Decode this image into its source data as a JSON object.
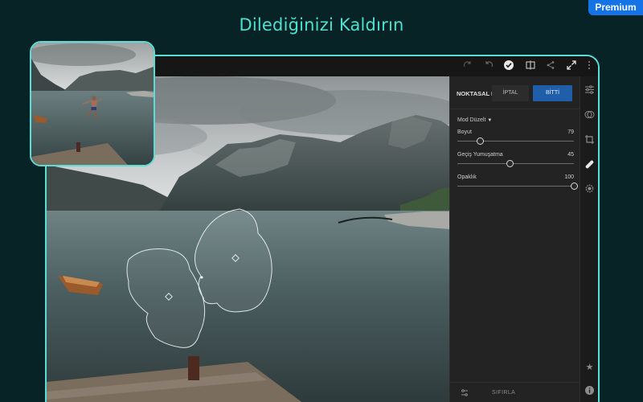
{
  "header": {
    "title": "Dilediğinizi Kaldırın"
  },
  "badge": {
    "label": "Premium"
  },
  "topbar": {
    "icons": [
      "redo-icon",
      "undo-icon",
      "checkmark-icon",
      "compare-icon",
      "share-icon",
      "fullscreen-icon",
      "more-icon"
    ]
  },
  "panel": {
    "title": "NOKTASAL DÜZELTME",
    "cancel_label": "İPTAL",
    "done_label": "BİTTİ",
    "mode_label": "Mod Düzelt",
    "sliders": [
      {
        "label": "Boyut",
        "value": "79",
        "fraction": 0.19
      },
      {
        "label": "Geçiş Yumuşatma",
        "value": "45",
        "fraction": 0.45
      },
      {
        "label": "Opaklık",
        "value": "100",
        "fraction": 1.0
      }
    ],
    "reset_label": "SIFIRLA"
  },
  "toolstrip": {
    "icons": [
      "sliders-icon",
      "presets-icon",
      "crop-icon",
      "healing-brush-icon",
      "selective-icon",
      "star-icon",
      "info-icon"
    ]
  },
  "colors": {
    "accent": "#59ddd6",
    "title": "#4ee0d0",
    "premium": "#1473e6",
    "done_button": "#1f5ea8"
  }
}
